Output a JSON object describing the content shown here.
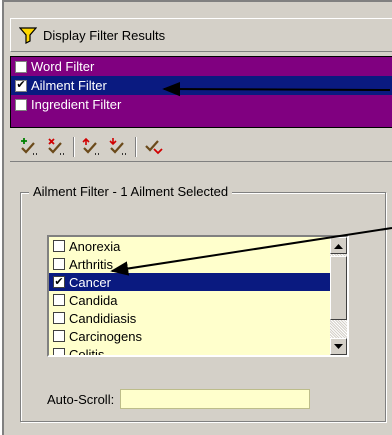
{
  "header": {
    "title": "Display Filter Results",
    "icon": "funnel-icon"
  },
  "filters": [
    {
      "label": "Word Filter",
      "checked": false,
      "selected": false
    },
    {
      "label": "Ailment Filter",
      "checked": true,
      "selected": true
    },
    {
      "label": "Ingredient Filter",
      "checked": false,
      "selected": false
    }
  ],
  "toolbar": {
    "buttons": [
      "check-add-icon",
      "check-remove-icon",
      "check-up-icon",
      "check-down-icon",
      "check-clear-icon"
    ]
  },
  "group": {
    "title": "Ailment Filter - 1 Ailment Selected"
  },
  "ailments": [
    {
      "label": "Anorexia",
      "checked": false,
      "selected": false
    },
    {
      "label": "Arthritis",
      "checked": false,
      "selected": false
    },
    {
      "label": "Cancer",
      "checked": true,
      "selected": true
    },
    {
      "label": "Candida",
      "checked": false,
      "selected": false
    },
    {
      "label": "Candidiasis",
      "checked": false,
      "selected": false
    },
    {
      "label": "Carcinogens",
      "checked": false,
      "selected": false
    },
    {
      "label": "Colitis",
      "checked": false,
      "selected": false
    }
  ],
  "autoscroll": {
    "label": "Auto-Scroll:",
    "value": ""
  },
  "colors": {
    "filter_bg": "#800080",
    "selection": "#0a1a80",
    "list_bg": "#ffffcc"
  }
}
